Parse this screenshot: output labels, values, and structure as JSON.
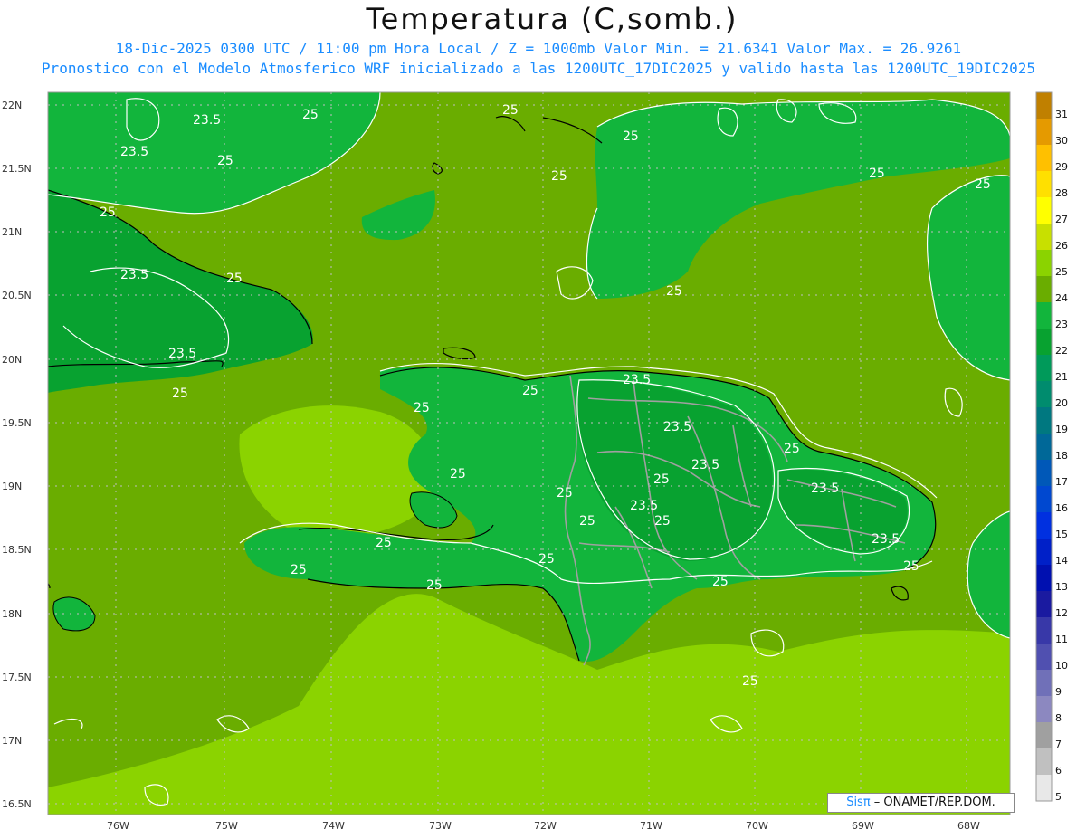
{
  "title": "Temperatura (C,somb.)",
  "subtitle_line1": "18-Dic-2025 0300 UTC / 11:00 pm Hora Local / Z = 1000mb  Valor Min. = 21.6341  Valor Max. = 26.9261",
  "subtitle_line2": "Pronostico con el Modelo Atmosferico WRF inicializado a las 1200UTC_17DIC2025 y valido hasta las  1200UTC_19DIC2025",
  "credit": {
    "brand": "Sis",
    "brand_symbol": "π",
    "text": " – ONAMET/REP.DOM."
  },
  "map": {
    "lat_labels": [
      "22N",
      "21.5N",
      "21N",
      "20.5N",
      "20N",
      "19.5N",
      "19N",
      "18.5N",
      "18N",
      "17.5N",
      "17N",
      "16.5N"
    ],
    "lon_labels": [
      "76W",
      "75W",
      "74W",
      "73W",
      "72W",
      "71W",
      "70W",
      "69W",
      "68W"
    ],
    "contour_labels": [
      "25",
      "23.5"
    ],
    "colors": {
      "sea_25": "#6aad00",
      "land_24": "#12b53c",
      "land_23": "#08a230",
      "cool_26": "#8bd300",
      "coast": "#000000",
      "borders": "#a0a0a0",
      "contours": "#ffffff"
    }
  },
  "legend": {
    "values": [
      "31",
      "30",
      "29",
      "28",
      "27",
      "26",
      "25",
      "24",
      "23",
      "22",
      "21",
      "20",
      "19",
      "18",
      "17",
      "16",
      "15",
      "14",
      "13",
      "12",
      "11",
      "10",
      "9",
      "8",
      "7",
      "6",
      "5"
    ],
    "colors": [
      "#c08000",
      "#e59a00",
      "#ffc000",
      "#ffe000",
      "#ffff00",
      "#c8e000",
      "#8bd300",
      "#6aad00",
      "#12b53c",
      "#08a230",
      "#009a5a",
      "#008c6e",
      "#007880",
      "#006898",
      "#0058b8",
      "#0048d0",
      "#0030e0",
      "#0020c8",
      "#0010b0",
      "#1a1aa0",
      "#3838a8",
      "#5050b0",
      "#7070b8",
      "#8c88c0",
      "#a0a0a0",
      "#c0c0c0",
      "#e8e8e8"
    ]
  }
}
